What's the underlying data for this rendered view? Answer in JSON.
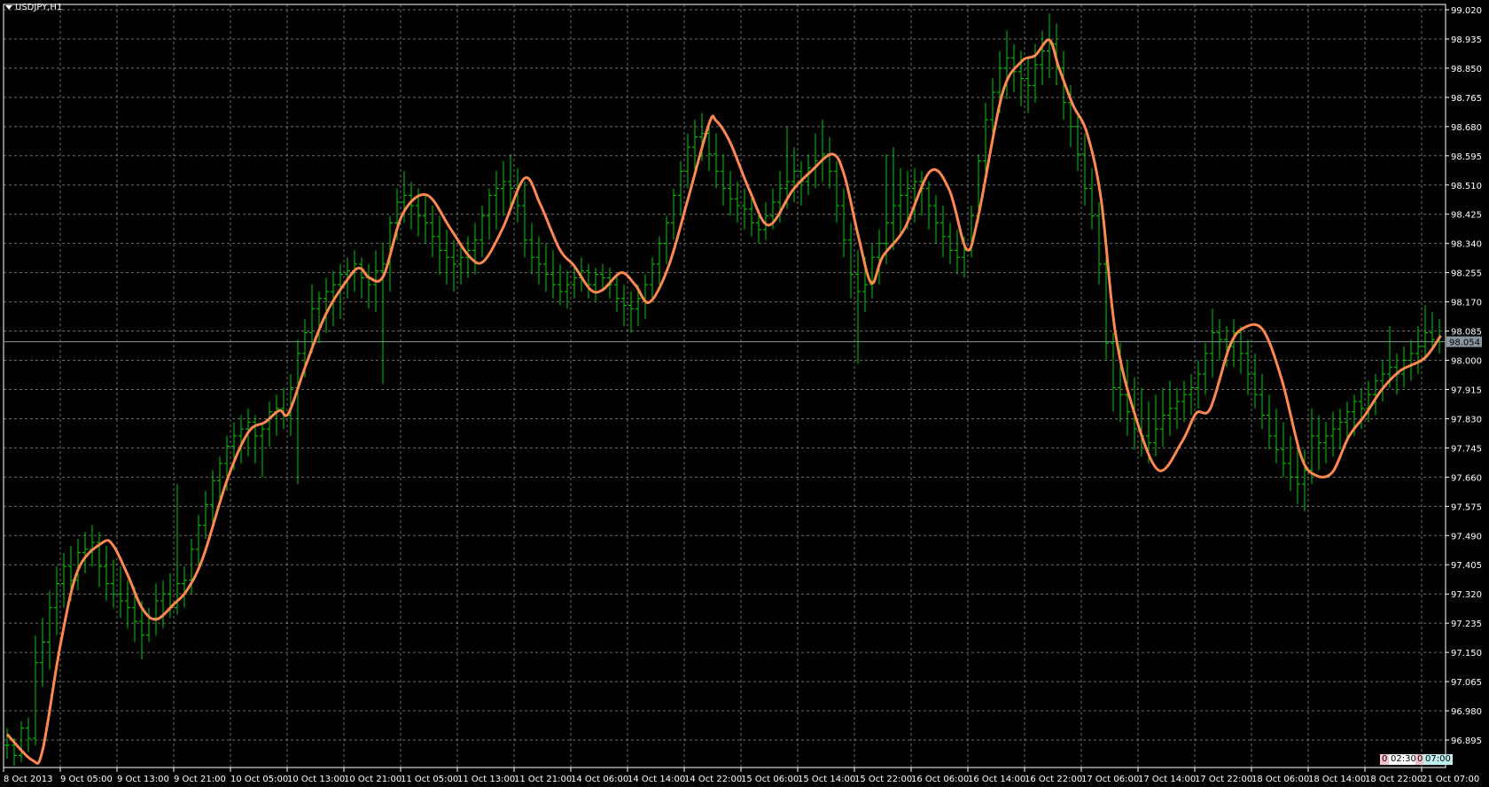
{
  "window": {
    "title": "USDJPY,H1"
  },
  "colors": {
    "background": "#000000",
    "grid": "#9a9a9a",
    "bars": "#00d000",
    "ma": "#ff8850",
    "axis": "#ffffff",
    "price_line": "#8a97a0",
    "price_label_bg": "#8a97a0"
  },
  "timer": {
    "left_count": "0",
    "left_time": "02:30",
    "right_count": "0",
    "right_time": "07:00"
  },
  "chart_data": {
    "type": "bar",
    "symbol": "USDJPY",
    "timeframe": "H1",
    "ylim": [
      96.895,
      99.02
    ],
    "yticks": [
      "99.020",
      "98.935",
      "98.850",
      "98.765",
      "98.680",
      "98.595",
      "98.510",
      "98.425",
      "98.340",
      "98.255",
      "98.170",
      "98.085",
      "98.000",
      "97.915",
      "97.830",
      "97.745",
      "97.660",
      "97.575",
      "97.490",
      "97.405",
      "97.320",
      "97.235",
      "97.150",
      "97.065",
      "96.980",
      "96.895"
    ],
    "xticks": [
      "8 Oct 2013",
      "9 Oct 05:00",
      "9 Oct 13:00",
      "9 Oct 21:00",
      "10 Oct 05:00",
      "10 Oct 13:00",
      "10 Oct 21:00",
      "11 Oct 05:00",
      "11 Oct 13:00",
      "11 Oct 21:00",
      "14 Oct 06:00",
      "14 Oct 14:00",
      "14 Oct 22:00",
      "15 Oct 06:00",
      "15 Oct 14:00",
      "15 Oct 22:00",
      "16 Oct 06:00",
      "16 Oct 14:00",
      "16 Oct 22:00",
      "17 Oct 06:00",
      "17 Oct 14:00",
      "17 Oct 22:00",
      "18 Oct 06:00",
      "18 Oct 14:00",
      "18 Oct 22:00",
      "21 Oct 07:00"
    ],
    "bars_per_xtick": 8,
    "current_price": "98.054",
    "bars_hlc": [
      [
        96.93,
        96.84,
        96.88
      ],
      [
        96.9,
        96.82,
        96.85
      ],
      [
        96.95,
        96.83,
        96.93
      ],
      [
        96.96,
        96.86,
        96.9
      ],
      [
        97.2,
        96.88,
        97.12
      ],
      [
        97.25,
        97.05,
        97.18
      ],
      [
        97.33,
        97.1,
        97.28
      ],
      [
        97.4,
        97.2,
        97.35
      ],
      [
        97.44,
        97.28,
        97.4
      ],
      [
        97.46,
        97.3,
        97.36
      ],
      [
        97.48,
        97.33,
        97.44
      ],
      [
        97.5,
        97.38,
        97.45
      ],
      [
        97.52,
        97.4,
        97.47
      ],
      [
        97.5,
        97.34,
        97.4
      ],
      [
        97.46,
        97.3,
        97.35
      ],
      [
        97.42,
        97.28,
        97.32
      ],
      [
        97.4,
        97.25,
        97.3
      ],
      [
        97.36,
        97.22,
        97.28
      ],
      [
        97.34,
        97.18,
        97.24
      ],
      [
        97.3,
        97.13,
        97.2
      ],
      [
        97.28,
        97.18,
        97.25
      ],
      [
        97.35,
        97.2,
        97.3
      ],
      [
        97.36,
        97.22,
        97.32
      ],
      [
        97.38,
        97.25,
        97.28
      ],
      [
        97.64,
        97.26,
        97.35
      ],
      [
        97.4,
        97.28,
        97.36
      ],
      [
        97.48,
        97.32,
        97.45
      ],
      [
        97.55,
        97.4,
        97.52
      ],
      [
        97.62,
        97.48,
        97.58
      ],
      [
        97.68,
        97.52,
        97.65
      ],
      [
        97.72,
        97.58,
        97.7
      ],
      [
        97.78,
        97.62,
        97.75
      ],
      [
        97.82,
        97.68,
        97.78
      ],
      [
        97.84,
        97.7,
        97.8
      ],
      [
        97.86,
        97.72,
        97.82
      ],
      [
        97.84,
        97.7,
        97.78
      ],
      [
        97.82,
        97.66,
        97.8
      ],
      [
        97.88,
        97.75,
        97.85
      ],
      [
        97.9,
        97.78,
        97.86
      ],
      [
        97.92,
        97.8,
        97.84
      ],
      [
        97.96,
        97.78,
        97.92
      ],
      [
        98.06,
        97.64,
        98.02
      ],
      [
        98.12,
        97.95,
        98.08
      ],
      [
        98.22,
        98.02,
        98.15
      ],
      [
        98.2,
        98.05,
        98.18
      ],
      [
        98.24,
        98.08,
        98.2
      ],
      [
        98.26,
        98.1,
        98.22
      ],
      [
        98.28,
        98.12,
        98.25
      ],
      [
        98.3,
        98.18,
        98.26
      ],
      [
        98.32,
        98.2,
        98.28
      ],
      [
        98.3,
        98.18,
        98.24
      ],
      [
        98.28,
        98.15,
        98.22
      ],
      [
        98.32,
        98.14,
        98.26
      ],
      [
        98.34,
        97.93,
        98.28
      ],
      [
        98.42,
        98.2,
        98.4
      ],
      [
        98.5,
        98.35,
        98.46
      ],
      [
        98.55,
        98.4,
        98.48
      ],
      [
        98.52,
        98.38,
        98.45
      ],
      [
        98.5,
        98.36,
        98.42
      ],
      [
        98.48,
        98.34,
        98.4
      ],
      [
        98.45,
        98.3,
        98.36
      ],
      [
        98.42,
        98.25,
        98.32
      ],
      [
        98.38,
        98.22,
        98.3
      ],
      [
        98.35,
        98.2,
        98.28
      ],
      [
        98.34,
        98.22,
        98.3
      ],
      [
        98.36,
        98.24,
        98.32
      ],
      [
        98.4,
        98.25,
        98.35
      ],
      [
        98.45,
        98.3,
        98.42
      ],
      [
        98.5,
        98.35,
        98.48
      ],
      [
        98.55,
        98.38,
        98.5
      ],
      [
        98.58,
        98.42,
        98.52
      ],
      [
        98.6,
        98.45,
        98.5
      ],
      [
        98.56,
        98.4,
        98.45
      ],
      [
        98.52,
        98.3,
        98.35
      ],
      [
        98.4,
        98.25,
        98.3
      ],
      [
        98.36,
        98.22,
        98.28
      ],
      [
        98.34,
        98.2,
        98.25
      ],
      [
        98.32,
        98.18,
        98.22
      ],
      [
        98.28,
        98.16,
        98.2
      ],
      [
        98.26,
        98.15,
        98.22
      ],
      [
        98.28,
        98.18,
        98.24
      ],
      [
        98.3,
        98.2,
        98.26
      ],
      [
        98.28,
        98.18,
        98.22
      ],
      [
        98.27,
        98.17,
        98.25
      ],
      [
        98.28,
        98.2,
        98.24
      ],
      [
        98.27,
        98.18,
        98.22
      ],
      [
        98.25,
        98.14,
        98.18
      ],
      [
        98.22,
        98.1,
        98.16
      ],
      [
        98.2,
        98.08,
        98.15
      ],
      [
        98.22,
        98.1,
        98.18
      ],
      [
        98.25,
        98.12,
        98.22
      ],
      [
        98.3,
        98.18,
        98.28
      ],
      [
        98.36,
        98.22,
        98.34
      ],
      [
        98.42,
        98.28,
        98.4
      ],
      [
        98.5,
        98.35,
        98.48
      ],
      [
        98.58,
        98.42,
        98.55
      ],
      [
        98.66,
        98.5,
        98.62
      ],
      [
        98.7,
        98.55,
        98.65
      ],
      [
        98.72,
        98.58,
        98.66
      ],
      [
        98.7,
        98.55,
        98.6
      ],
      [
        98.66,
        98.5,
        98.55
      ],
      [
        98.6,
        98.45,
        98.5
      ],
      [
        98.55,
        98.42,
        98.47
      ],
      [
        98.52,
        98.4,
        98.45
      ],
      [
        98.5,
        98.38,
        98.44
      ],
      [
        98.47,
        98.36,
        98.4
      ],
      [
        98.44,
        98.34,
        98.38
      ],
      [
        98.46,
        98.35,
        98.42
      ],
      [
        98.5,
        98.38,
        98.46
      ],
      [
        98.55,
        98.4,
        98.5
      ],
      [
        98.68,
        98.44,
        98.52
      ],
      [
        98.62,
        98.46,
        98.55
      ],
      [
        98.58,
        98.45,
        98.52
      ],
      [
        98.6,
        98.48,
        98.56
      ],
      [
        98.66,
        98.5,
        98.58
      ],
      [
        98.7,
        98.52,
        98.6
      ],
      [
        98.65,
        98.5,
        98.55
      ],
      [
        98.58,
        98.4,
        98.45
      ],
      [
        98.5,
        98.3,
        98.35
      ],
      [
        98.4,
        98.18,
        98.25
      ],
      [
        98.32,
        97.99,
        98.2
      ],
      [
        98.3,
        98.14,
        98.22
      ],
      [
        98.34,
        98.18,
        98.3
      ],
      [
        98.38,
        98.22,
        98.34
      ],
      [
        98.6,
        98.28,
        98.4
      ],
      [
        98.62,
        98.32,
        98.45
      ],
      [
        98.56,
        98.36,
        98.48
      ],
      [
        98.55,
        98.38,
        98.5
      ],
      [
        98.56,
        98.4,
        98.52
      ],
      [
        98.55,
        98.42,
        98.5
      ],
      [
        98.52,
        98.38,
        98.45
      ],
      [
        98.48,
        98.34,
        98.4
      ],
      [
        98.45,
        98.3,
        98.36
      ],
      [
        98.4,
        98.28,
        98.32
      ],
      [
        98.38,
        98.25,
        98.3
      ],
      [
        98.36,
        98.24,
        98.32
      ],
      [
        98.45,
        98.3,
        98.42
      ],
      [
        98.6,
        98.4,
        98.58
      ],
      [
        98.75,
        98.55,
        98.7
      ],
      [
        98.82,
        98.65,
        98.78
      ],
      [
        98.9,
        98.72,
        98.85
      ],
      [
        98.96,
        98.76,
        98.88
      ],
      [
        98.92,
        98.78,
        98.84
      ],
      [
        98.9,
        98.74,
        98.82
      ],
      [
        98.88,
        98.72,
        98.8
      ],
      [
        98.92,
        98.75,
        98.86
      ],
      [
        98.96,
        98.8,
        98.9
      ],
      [
        99.01,
        98.82,
        98.92
      ],
      [
        98.98,
        98.8,
        98.85
      ],
      [
        98.9,
        98.7,
        98.75
      ],
      [
        98.8,
        98.62,
        98.68
      ],
      [
        98.72,
        98.55,
        98.6
      ],
      [
        98.66,
        98.45,
        98.5
      ],
      [
        98.56,
        98.38,
        98.42
      ],
      [
        98.46,
        98.22,
        98.28
      ],
      [
        98.3,
        98.0,
        98.05
      ],
      [
        98.08,
        97.85,
        97.92
      ],
      [
        98.05,
        97.82,
        97.9
      ],
      [
        98.0,
        97.78,
        97.85
      ],
      [
        97.95,
        97.74,
        97.8
      ],
      [
        97.92,
        97.72,
        97.78
      ],
      [
        97.88,
        97.7,
        97.76
      ],
      [
        97.9,
        97.72,
        97.8
      ],
      [
        97.92,
        97.75,
        97.84
      ],
      [
        97.94,
        97.78,
        97.86
      ],
      [
        97.92,
        97.8,
        97.88
      ],
      [
        97.94,
        97.82,
        97.9
      ],
      [
        97.96,
        97.84,
        97.92
      ],
      [
        98.0,
        97.86,
        97.96
      ],
      [
        98.05,
        97.9,
        98.02
      ],
      [
        98.15,
        97.95,
        98.08
      ],
      [
        98.12,
        98.0,
        98.06
      ],
      [
        98.1,
        97.98,
        98.04
      ],
      [
        98.12,
        97.98,
        98.08
      ],
      [
        98.1,
        97.96,
        98.02
      ],
      [
        98.06,
        97.9,
        97.96
      ],
      [
        98.02,
        97.86,
        97.9
      ],
      [
        97.96,
        97.8,
        97.84
      ],
      [
        97.9,
        97.74,
        97.78
      ],
      [
        97.86,
        97.7,
        97.74
      ],
      [
        97.82,
        97.66,
        97.7
      ],
      [
        97.78,
        97.62,
        97.66
      ],
      [
        97.75,
        97.58,
        97.64
      ],
      [
        97.74,
        97.56,
        97.68
      ],
      [
        97.86,
        97.64,
        97.78
      ],
      [
        97.84,
        97.68,
        97.76
      ],
      [
        97.82,
        97.7,
        97.78
      ],
      [
        97.85,
        97.72,
        97.8
      ],
      [
        97.86,
        97.74,
        97.82
      ],
      [
        97.88,
        97.76,
        97.85
      ],
      [
        97.9,
        97.78,
        97.88
      ],
      [
        97.92,
        97.8,
        97.86
      ],
      [
        97.94,
        97.82,
        97.9
      ],
      [
        97.96,
        97.84,
        97.94
      ],
      [
        98.0,
        97.88,
        97.96
      ],
      [
        98.1,
        97.92,
        97.98
      ],
      [
        98.02,
        97.9,
        97.96
      ],
      [
        98.04,
        97.92,
        98.0
      ],
      [
        98.06,
        97.94,
        98.02
      ],
      [
        98.1,
        97.96,
        98.04
      ],
      [
        98.16,
        98.0,
        98.08
      ],
      [
        98.14,
        98.04,
        98.06
      ],
      [
        98.12,
        98.02,
        98.054
      ]
    ],
    "moving_average": {
      "name": "MA",
      "points": [
        [
          0,
          96.912
        ],
        [
          3.5,
          96.837
        ],
        [
          5,
          96.865
        ],
        [
          7.5,
          97.17
        ],
        [
          10,
          97.39
        ],
        [
          13.5,
          97.47
        ],
        [
          15,
          97.46
        ],
        [
          17,
          97.376
        ],
        [
          19,
          97.28
        ],
        [
          21,
          97.246
        ],
        [
          23.5,
          97.29
        ],
        [
          25.5,
          97.335
        ],
        [
          27.7,
          97.43
        ],
        [
          31,
          97.65
        ],
        [
          34,
          97.79
        ],
        [
          36.4,
          97.82
        ],
        [
          38.4,
          97.854
        ],
        [
          39.7,
          97.846
        ],
        [
          42.1,
          97.984
        ],
        [
          45,
          98.136
        ],
        [
          48.4,
          98.246
        ],
        [
          49.8,
          98.268
        ],
        [
          51.1,
          98.24
        ],
        [
          53.1,
          98.246
        ],
        [
          55.8,
          98.426
        ],
        [
          59.2,
          98.481
        ],
        [
          62.5,
          98.384
        ],
        [
          65.2,
          98.302
        ],
        [
          67.2,
          98.288
        ],
        [
          69.9,
          98.384
        ],
        [
          73,
          98.53
        ],
        [
          75.2,
          98.454
        ],
        [
          77.9,
          98.324
        ],
        [
          80,
          98.274
        ],
        [
          82.3,
          98.205
        ],
        [
          84,
          98.205
        ],
        [
          86.6,
          98.255
        ],
        [
          88.6,
          98.219
        ],
        [
          90.6,
          98.169
        ],
        [
          93.3,
          98.274
        ],
        [
          96,
          98.467
        ],
        [
          99,
          98.688
        ],
        [
          100,
          98.697
        ],
        [
          102,
          98.633
        ],
        [
          104.7,
          98.495
        ],
        [
          107.4,
          98.393
        ],
        [
          110.8,
          98.495
        ],
        [
          113.4,
          98.55
        ],
        [
          116.4,
          98.6
        ],
        [
          118.1,
          98.537
        ],
        [
          120.1,
          98.357
        ],
        [
          121.9,
          98.225
        ],
        [
          123.5,
          98.302
        ],
        [
          126.6,
          98.384
        ],
        [
          130.2,
          98.55
        ],
        [
          132.9,
          98.495
        ],
        [
          135.3,
          98.324
        ],
        [
          136.9,
          98.412
        ],
        [
          140.3,
          98.771
        ],
        [
          143,
          98.868
        ],
        [
          145,
          98.887
        ],
        [
          147,
          98.932
        ],
        [
          148.3,
          98.854
        ],
        [
          150.3,
          98.744
        ],
        [
          152.3,
          98.661
        ],
        [
          154.3,
          98.467
        ],
        [
          156.3,
          98.081
        ],
        [
          159,
          97.846
        ],
        [
          162.4,
          97.68
        ],
        [
          165.7,
          97.763
        ],
        [
          167.7,
          97.846
        ],
        [
          169.7,
          97.86
        ],
        [
          172.4,
          98.039
        ],
        [
          174.4,
          98.094
        ],
        [
          177.1,
          98.089
        ],
        [
          179.8,
          97.942
        ],
        [
          182.5,
          97.721
        ],
        [
          184.5,
          97.666
        ],
        [
          186.9,
          97.674
        ],
        [
          189.2,
          97.777
        ],
        [
          191.5,
          97.84
        ],
        [
          193.9,
          97.915
        ],
        [
          196.5,
          97.97
        ],
        [
          199.9,
          98.006
        ],
        [
          202.2,
          98.072
        ]
      ]
    }
  }
}
